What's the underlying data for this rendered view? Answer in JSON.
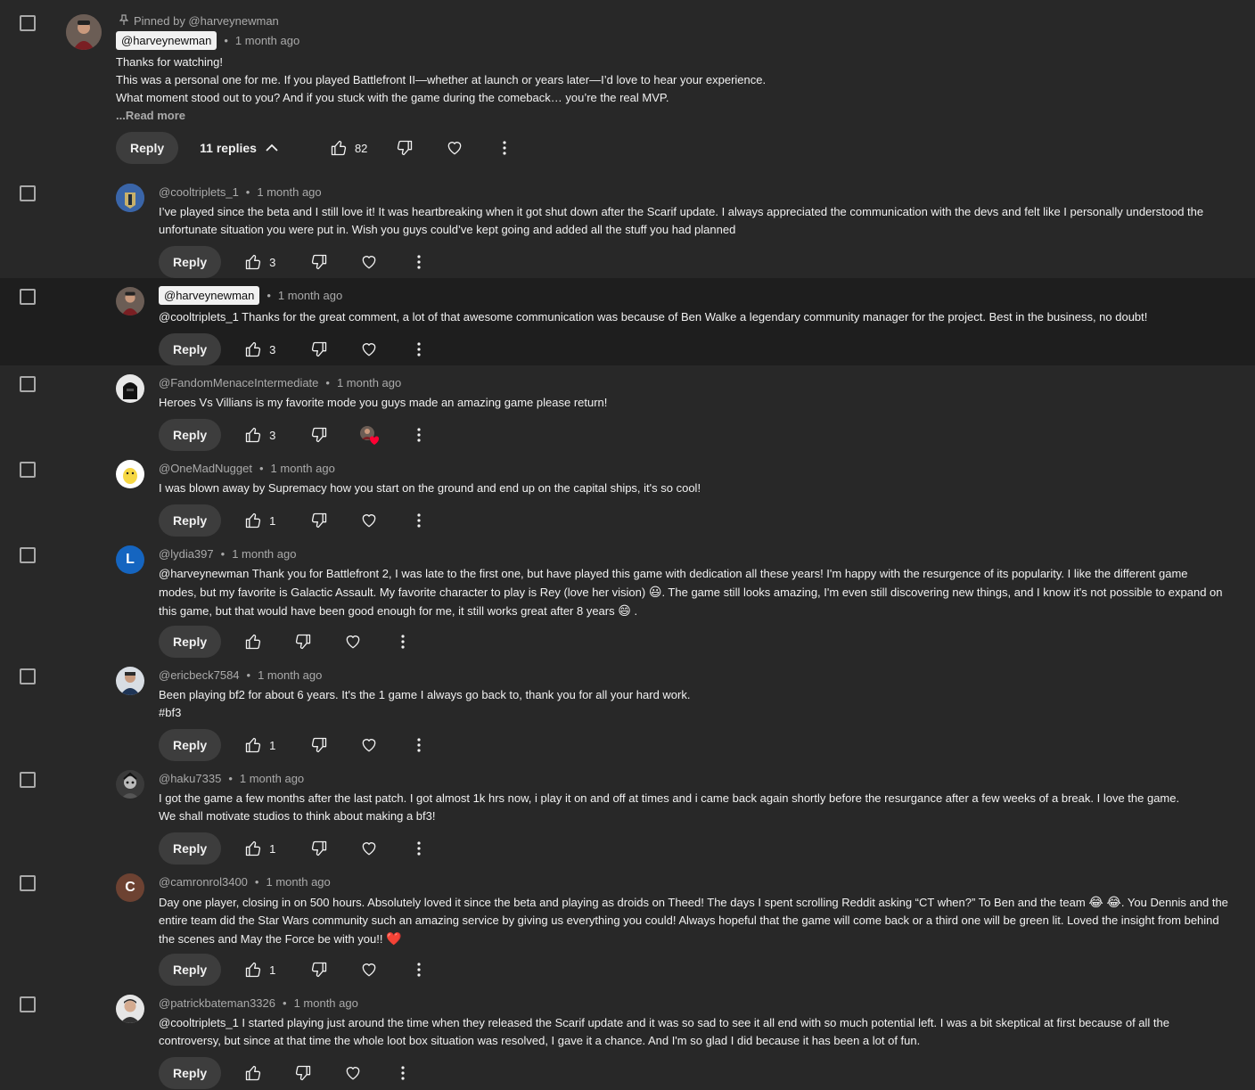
{
  "pinned_comment": {
    "pinned_label": "Pinned by @harveynewman",
    "author": "@harveynewman",
    "time": "1 month ago",
    "lines": [
      "Thanks for watching!",
      "This was a personal one for me. If you played Battlefront II—whether at launch or years later—I’d love to hear your experience.",
      "What moment stood out to you? And if you stuck with the game during the comeback… you’re the real MVP."
    ],
    "read_more": "...Read more",
    "reply_label": "Reply",
    "replies_label": "11 replies",
    "likes": "82"
  },
  "replies": [
    {
      "author": "@cooltriplets_1",
      "time": "1 month ago",
      "text": "I’ve played since the beta and I still love it! It was heartbreaking when it got shut down after the Scarif update. I always appreciated the communication with the devs and felt like I personally understood the unfortunate situation you were put in. Wish you guys could’ve kept going and added all the stuff you had planned",
      "likes": "3",
      "reply_label": "Reply"
    },
    {
      "author": "@harveynewman",
      "time": "1 month ago",
      "text": "@cooltriplets_1 Thanks for the great comment, a lot of that awesome communication was because of Ben Walke a legendary community manager for the project. Best in the business, no doubt!",
      "likes": "3",
      "reply_label": "Reply"
    },
    {
      "author": "@FandomMenaceIntermediate",
      "time": "1 month ago",
      "text": "Heroes Vs Villians is my favorite mode you guys made an amazing game please return!",
      "likes": "3",
      "reply_label": "Reply"
    },
    {
      "author": "@OneMadNugget",
      "time": "1 month ago",
      "text": "I was blown away by Supremacy how you start on the ground and end up on the capital ships, it's so cool!",
      "likes": "1",
      "reply_label": "Reply"
    },
    {
      "author": "@lydia397",
      "time": "1 month ago",
      "avatar_letter": "L",
      "text_parts": [
        "@harveynewman Thank you for Battlefront 2, I was late to the first one, but have played this game with dedication all these years! I'm happy with the resurgence of its popularity. I like the different game modes, but my favorite is Galactic Assault. My favorite character to play is Rey (love her vision)",
        "😃",
        ". The game still looks amazing, I'm even still discovering new things, and I know it's not possible to expand on this game, but that would have been good enough for me, it still works great after 8 years",
        "😄",
        "."
      ],
      "likes": "",
      "reply_label": "Reply"
    },
    {
      "author": "@ericbeck7584",
      "time": "1 month ago",
      "lines": [
        "Been playing bf2 for about 6 years. It's the 1 game I always go back to, thank you for all your hard work.",
        "#bf3"
      ],
      "likes": "1",
      "reply_label": "Reply"
    },
    {
      "author": "@haku7335",
      "time": "1 month ago",
      "lines": [
        "I got the game a few months after the last patch. I got almost 1k hrs now, i play it on and off at times and i came back again shortly before the resurgance after a few weeks of a break. I love the game.",
        "We shall motivate studios to think about making a bf3!"
      ],
      "likes": "1",
      "reply_label": "Reply"
    },
    {
      "author": "@camronrol3400",
      "time": "1 month ago",
      "avatar_letter": "C",
      "text_parts": [
        "Day one player,  closing in on 500 hours. Absolutely loved it since the beta and playing as droids on Theed! The days I spent scrolling Reddit asking “CT when?” To Ben and the team",
        "😂 😂",
        ". You Dennis and the entire team did the Star Wars community such an amazing service by giving us everything you could! Always hopeful that the game will come back or a third one will be green lit. Loved the insight from behind the scenes and May the Force be with you!!",
        "❤️"
      ],
      "likes": "1",
      "reply_label": "Reply"
    },
    {
      "author": "@patrickbateman3326",
      "time": "1 month ago",
      "text": "@cooltriplets_1 I started playing just around the time when they released the Scarif update and it was so sad to see it all end with so much potential left. I was a bit skeptical at first because of all the controversy, but since at that time the whole loot box situation was resolved, I gave it a chance. And I'm so glad I did because it has been a lot of fun.",
      "likes": "",
      "reply_label": "Reply"
    }
  ],
  "colors": {
    "background": "#282828",
    "highlight_row": "#1e1e1e",
    "text": "#f1f1f1",
    "muted": "#aaaaaa",
    "button": "#3d3d3d",
    "heart": "#ff0033"
  },
  "icons": [
    "pin-icon",
    "chevron-up-icon",
    "thumbs-up-icon",
    "thumbs-down-icon",
    "heart-icon",
    "more-vert-icon",
    "creator-heart-icon"
  ]
}
